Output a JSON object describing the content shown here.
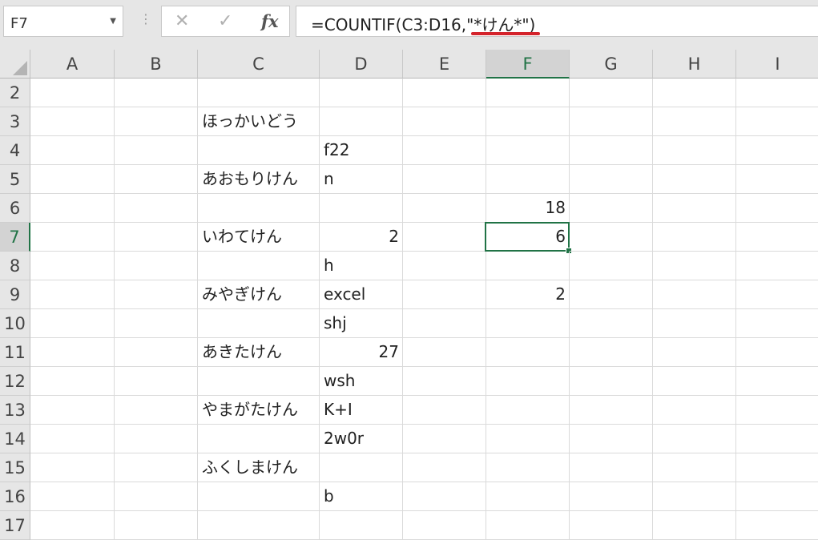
{
  "name_box": {
    "value": "F7"
  },
  "formula_bar": {
    "separator": "⋮",
    "cancel_icon": "✕",
    "enter_icon": "✓",
    "fx_label": "fx",
    "formula": "=COUNTIF(C3:D16,\"*けん*\")",
    "highlight_color": "#d4232b"
  },
  "accent_color": "#217346",
  "active_cell": "F7",
  "columns": [
    "A",
    "B",
    "C",
    "D",
    "E",
    "F",
    "G",
    "H",
    "I"
  ],
  "rows": [
    "2",
    "3",
    "4",
    "5",
    "6",
    "7",
    "8",
    "9",
    "10",
    "11",
    "12",
    "13",
    "14",
    "15",
    "16",
    "17"
  ],
  "cells": {
    "C3": {
      "value": "ほっかいどう",
      "type": "text"
    },
    "D4": {
      "value": "f22",
      "type": "text"
    },
    "C5": {
      "value": "あおもりけん",
      "type": "text"
    },
    "D5": {
      "value": "n",
      "type": "text"
    },
    "F6": {
      "value": "18",
      "type": "num"
    },
    "C7": {
      "value": "いわてけん",
      "type": "text"
    },
    "D7": {
      "value": "2",
      "type": "num"
    },
    "F7": {
      "value": "6",
      "type": "num"
    },
    "D8": {
      "value": "h",
      "type": "text"
    },
    "C9": {
      "value": "みやぎけん",
      "type": "text"
    },
    "D9": {
      "value": "excel",
      "type": "text"
    },
    "F9": {
      "value": "2",
      "type": "num"
    },
    "D10": {
      "value": "shj",
      "type": "text"
    },
    "C11": {
      "value": "あきたけん",
      "type": "text"
    },
    "D11": {
      "value": "27",
      "type": "num"
    },
    "D12": {
      "value": "wsh",
      "type": "text"
    },
    "C13": {
      "value": "やまがたけん",
      "type": "text"
    },
    "D13": {
      "value": "K+I",
      "type": "text"
    },
    "D14": {
      "value": "2w0r",
      "type": "text"
    },
    "C15": {
      "value": "ふくしまけん",
      "type": "text"
    },
    "D16": {
      "value": "b",
      "type": "text"
    }
  }
}
